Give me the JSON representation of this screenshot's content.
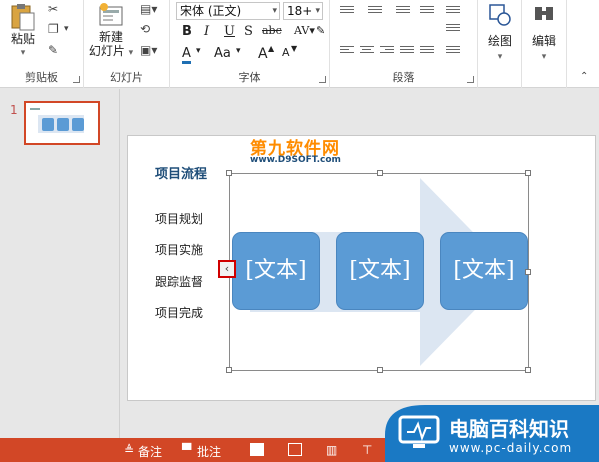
{
  "ribbon": {
    "clipboard": {
      "label": "剪贴板",
      "paste": "粘贴"
    },
    "slides": {
      "label": "幻灯片",
      "new_slide_line1": "新建",
      "new_slide_line2": "幻灯片"
    },
    "font": {
      "label": "字体",
      "font_name": "宋体 (正文)",
      "font_size": "18+",
      "bold": "B",
      "italic": "I",
      "underline": "U",
      "strike": "S",
      "spacing": "abc",
      "change_case": "Aa",
      "grow": "A",
      "shrink": "A",
      "font_color": "A"
    },
    "paragraph": {
      "label": "段落"
    },
    "drawing": {
      "label": "绘图"
    },
    "editing": {
      "label": "编辑"
    }
  },
  "thumbnails": {
    "slide_number": "1"
  },
  "slide": {
    "title": "项目流程",
    "bullets": [
      "项目规划",
      "项目实施",
      "跟踪监督",
      "项目完成"
    ],
    "smartart": {
      "boxes": [
        "[文本]",
        "[文本]",
        "[文本]"
      ],
      "expander": "‹"
    }
  },
  "statusbar": {
    "notes": "备注",
    "comments": "批注"
  },
  "watermarks": {
    "top_line1": "第九软件网",
    "top_line2": "www.D9SOFT.com",
    "brand": "电脑百科知识",
    "url": "www.pc-daily.com"
  },
  "colors": {
    "accent": "#d24726",
    "smartart_box": "#5b9bd5",
    "arrow": "#dce6f2"
  }
}
